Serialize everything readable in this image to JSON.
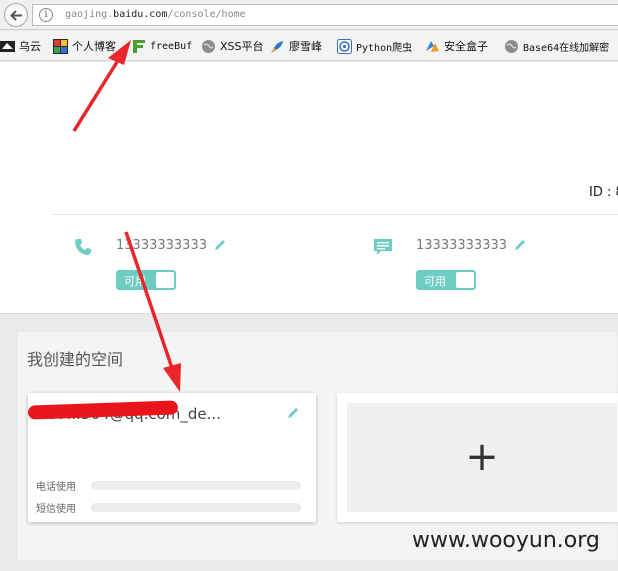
{
  "browser": {
    "url_prefix": "gaojing.",
    "url_domain": "baidu.com",
    "url_path": "/console/home"
  },
  "bookmarks": [
    {
      "label": "乌云",
      "icon": "wooyun-icon"
    },
    {
      "label": "个人博客",
      "icon": "blog-icon"
    },
    {
      "label": "freeBuf",
      "icon": "freebuf-icon"
    },
    {
      "label": "XSS平台",
      "icon": "globe-icon"
    },
    {
      "label": "廖雪峰",
      "icon": "rocket-icon"
    },
    {
      "label": "Python爬虫",
      "icon": "python-icon"
    },
    {
      "label": "安全盒子",
      "icon": "box-icon"
    },
    {
      "label": "Base64在线加解密",
      "icon": "globe-icon"
    }
  ],
  "profile": {
    "id_label": "ID : 8",
    "phone": "13333333333",
    "sms": "13333333333",
    "phone_status": "可用",
    "sms_status": "可用"
  },
  "spaces": {
    "title": "我创建的空间",
    "card": {
      "name": "807...364@qq.com_de...",
      "phone_usage_label": "电话使用",
      "sms_usage_label": "短信使用",
      "phone_usage": 0,
      "sms_usage": 0
    },
    "add_symbol": "+"
  },
  "watermark": "www.wooyun.org",
  "colors": {
    "accent": "#6dcdc2",
    "arrow": "#e8262b"
  }
}
